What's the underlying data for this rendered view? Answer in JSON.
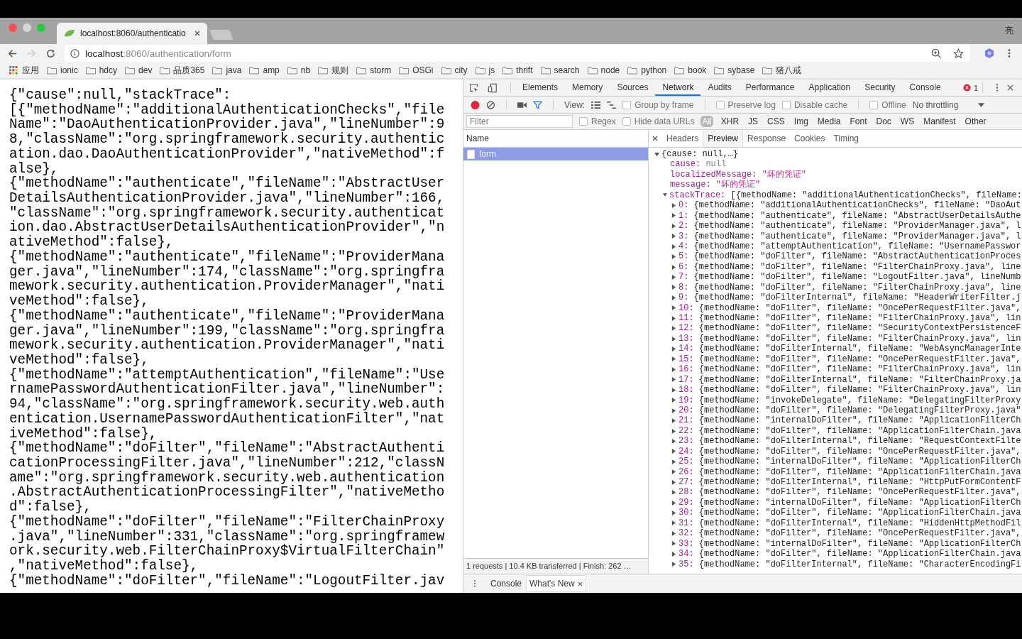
{
  "browser": {
    "tab_title": "localhost:8060/authenticatio",
    "profile_name": "亮",
    "address": {
      "host": "localhost",
      "path": ":8060/authentication/form"
    },
    "bookmarks": [
      {
        "label": "应用",
        "kind": "apps"
      },
      {
        "label": "ionic",
        "kind": "folder"
      },
      {
        "label": "hdcy",
        "kind": "folder"
      },
      {
        "label": "dev",
        "kind": "folder"
      },
      {
        "label": "品质365",
        "kind": "folder"
      },
      {
        "label": "java",
        "kind": "folder"
      },
      {
        "label": "amp",
        "kind": "folder"
      },
      {
        "label": "nb",
        "kind": "folder"
      },
      {
        "label": "规则",
        "kind": "folder"
      },
      {
        "label": "storm",
        "kind": "folder"
      },
      {
        "label": "OSGi",
        "kind": "folder"
      },
      {
        "label": "city",
        "kind": "folder"
      },
      {
        "label": "js",
        "kind": "folder"
      },
      {
        "label": "thrift",
        "kind": "folder"
      },
      {
        "label": "search",
        "kind": "folder"
      },
      {
        "label": "node",
        "kind": "folder"
      },
      {
        "label": "python",
        "kind": "folder"
      },
      {
        "label": "book",
        "kind": "folder"
      },
      {
        "label": "sybase",
        "kind": "folder"
      },
      {
        "label": "猪八戒",
        "kind": "folder"
      }
    ]
  },
  "page_text": [
    "{\"cause\":null,\"stackTrace\":",
    "[{\"methodName\":\"additionalAuthenticationChecks\",\"file",
    "Name\":\"DaoAuthenticationProvider.java\",\"lineNumber\":9",
    "8,\"className\":\"org.springframework.security.authentic",
    "ation.dao.DaoAuthenticationProvider\",\"nativeMethod\":f",
    "alse},",
    "{\"methodName\":\"authenticate\",\"fileName\":\"AbstractUser",
    "DetailsAuthenticationProvider.java\",\"lineNumber\":166,",
    "\"className\":\"org.springframework.security.authenticat",
    "ion.dao.AbstractUserDetailsAuthenticationProvider\",\"n",
    "ativeMethod\":false},",
    "{\"methodName\":\"authenticate\",\"fileName\":\"ProviderMana",
    "ger.java\",\"lineNumber\":174,\"className\":\"org.springfra",
    "mework.security.authentication.ProviderManager\",\"nati",
    "veMethod\":false},",
    "{\"methodName\":\"authenticate\",\"fileName\":\"ProviderMana",
    "ger.java\",\"lineNumber\":199,\"className\":\"org.springfra",
    "mework.security.authentication.ProviderManager\",\"nati",
    "veMethod\":false},",
    "{\"methodName\":\"attemptAuthentication\",\"fileName\":\"Use",
    "rnamePasswordAuthenticationFilter.java\",\"lineNumber\":",
    "94,\"className\":\"org.springframework.security.web.auth",
    "entication.UsernamePasswordAuthenticationFilter\",\"nat",
    "iveMethod\":false},",
    "{\"methodName\":\"doFilter\",\"fileName\":\"AbstractAuthenti",
    "cationProcessingFilter.java\",\"lineNumber\":212,\"classN",
    "ame\":\"org.springframework.security.web.authentication",
    ".AbstractAuthenticationProcessingFilter\",\"nativeMetho",
    "d\":false},",
    "{\"methodName\":\"doFilter\",\"fileName\":\"FilterChainProxy",
    ".java\",\"lineNumber\":331,\"className\":\"org.springframew",
    "ork.security.web.FilterChainProxy$VirtualFilterChain\"",
    ",\"nativeMethod\":false},",
    "{\"methodName\":\"doFilter\",\"fileName\":\"LogoutFilter.jav"
  ],
  "devtools": {
    "tabs": [
      {
        "label": "Elements",
        "selected": false
      },
      {
        "label": "Memory",
        "selected": false
      },
      {
        "label": "Sources",
        "selected": false
      },
      {
        "label": "Network",
        "selected": true
      },
      {
        "label": "Audits",
        "selected": false
      },
      {
        "label": "Performance",
        "selected": false
      },
      {
        "label": "Application",
        "selected": false
      },
      {
        "label": "Security",
        "selected": false
      },
      {
        "label": "Console",
        "selected": false
      }
    ],
    "error_count": "1",
    "toolbar": {
      "view_label": "View:",
      "checkboxes": [
        {
          "label": "Group by frame",
          "checked": false
        },
        {
          "label": "Preserve log",
          "checked": false
        },
        {
          "label": "Disable cache",
          "checked": false
        },
        {
          "label": "Offline",
          "checked": false
        }
      ],
      "throttling": "No throttling"
    },
    "filter": {
      "placeholder": "Filter",
      "checkboxes": [
        {
          "label": "Regex",
          "checked": false
        },
        {
          "label": "Hide data URLs",
          "checked": false
        }
      ],
      "types": [
        {
          "label": "All",
          "selected": true
        },
        {
          "label": "XHR",
          "selected": false
        },
        {
          "label": "JS",
          "selected": false
        },
        {
          "label": "CSS",
          "selected": false
        },
        {
          "label": "Img",
          "selected": false
        },
        {
          "label": "Media",
          "selected": false
        },
        {
          "label": "Font",
          "selected": false
        },
        {
          "label": "Doc",
          "selected": false
        },
        {
          "label": "WS",
          "selected": false
        },
        {
          "label": "Manifest",
          "selected": false
        },
        {
          "label": "Other",
          "selected": false
        }
      ]
    },
    "requests": {
      "column": "Name",
      "rows": [
        {
          "name": "form",
          "selected": true
        }
      ],
      "status": "1 requests | 10.4 KB transferred | Finish: 262 …"
    },
    "detail_tabs": [
      {
        "label": "Headers",
        "selected": false
      },
      {
        "label": "Preview",
        "selected": true
      },
      {
        "label": "Response",
        "selected": false
      },
      {
        "label": "Cookies",
        "selected": false
      },
      {
        "label": "Timing",
        "selected": false
      }
    ],
    "preview": {
      "summary": "{cause: null,…}",
      "expanded": true,
      "properties": [
        {
          "key": "cause:",
          "value": "null",
          "kind": "null"
        },
        {
          "key": "localizedMessage:",
          "value": "\"坏的凭证\"",
          "kind": "string"
        },
        {
          "key": "message:",
          "value": "\"坏的凭证\"",
          "kind": "string"
        },
        {
          "key": "stackTrace:",
          "value": "[{methodName: \"additionalAuthenticationChecks\", fileName:",
          "kind": "array",
          "expanded": true,
          "children": [
            {
              "index": "0:",
              "text": "{methodName: \"additionalAuthenticationChecks\", fileName: \"DaoAut",
              "expanded": false
            },
            {
              "index": "1:",
              "text": "{methodName: \"authenticate\", fileName: \"AbstractUserDetailsAuthe",
              "expanded": false
            },
            {
              "index": "2:",
              "text": "{methodName: \"authenticate\", fileName: \"ProviderManager.java\", l",
              "expanded": false
            },
            {
              "index": "3:",
              "text": "{methodName: \"authenticate\", fileName: \"ProviderManager.java\", l",
              "expanded": false
            },
            {
              "index": "4:",
              "text": "{methodName: \"attemptAuthentication\", fileName: \"UsernamePasswor",
              "expanded": false
            },
            {
              "index": "5:",
              "text": "{methodName: \"doFilter\", fileName: \"AbstractAuthenticationProces",
              "expanded": false
            },
            {
              "index": "6:",
              "text": "{methodName: \"doFilter\", fileName: \"FilterChainProxy.java\", line",
              "expanded": false
            },
            {
              "index": "7:",
              "text": "{methodName: \"doFilter\", fileName: \"LogoutFilter.java\", lineNumb",
              "expanded": false
            },
            {
              "index": "8:",
              "text": "{methodName: \"doFilter\", fileName: \"FilterChainProxy.java\", line",
              "expanded": false
            },
            {
              "index": "9:",
              "text": "{methodName: \"doFilterInternal\", fileName: \"HeaderWriterFilter.j",
              "expanded": false
            },
            {
              "index": "10:",
              "text": "{methodName: \"doFilter\", fileName: \"OncePerRequestFilter.java\",",
              "expanded": false
            },
            {
              "index": "11:",
              "text": "{methodName: \"doFilter\", fileName: \"FilterChainProxy.java\", lin",
              "expanded": false
            },
            {
              "index": "12:",
              "text": "{methodName: \"doFilter\", fileName: \"SecurityContextPersistenceF",
              "expanded": false
            },
            {
              "index": "13:",
              "text": "{methodName: \"doFilter\", fileName: \"FilterChainProxy.java\", lin",
              "expanded": false
            },
            {
              "index": "14:",
              "text": "{methodName: \"doFilterInternal\", fileName: \"WebAsyncManagerInte",
              "expanded": false
            },
            {
              "index": "15:",
              "text": "{methodName: \"doFilter\", fileName: \"OncePerRequestFilter.java\",",
              "expanded": false
            },
            {
              "index": "16:",
              "text": "{methodName: \"doFilter\", fileName: \"FilterChainProxy.java\", lin",
              "expanded": false
            },
            {
              "index": "17:",
              "text": "{methodName: \"doFilterInternal\", fileName: \"FilterChainProxy.ja",
              "expanded": false
            },
            {
              "index": "18:",
              "text": "{methodName: \"doFilter\", fileName: \"FilterChainProxy.java\", lin",
              "expanded": false
            },
            {
              "index": "19:",
              "text": "{methodName: \"invokeDelegate\", fileName: \"DelegatingFilterProxy",
              "expanded": false
            },
            {
              "index": "20:",
              "text": "{methodName: \"doFilter\", fileName: \"DelegatingFilterProxy.java\"",
              "expanded": false
            },
            {
              "index": "21:",
              "text": "{methodName: \"internalDoFilter\", fileName: \"ApplicationFilterCh",
              "expanded": false
            },
            {
              "index": "22:",
              "text": "{methodName: \"doFilter\", fileName: \"ApplicationFilterChain.java",
              "expanded": false
            },
            {
              "index": "23:",
              "text": "{methodName: \"doFilterInternal\", fileName: \"RequestContextFilte",
              "expanded": false
            },
            {
              "index": "24:",
              "text": "{methodName: \"doFilter\", fileName: \"OncePerRequestFilter.java\",",
              "expanded": false
            },
            {
              "index": "25:",
              "text": "{methodName: \"internalDoFilter\", fileName: \"ApplicationFilterCh",
              "expanded": false
            },
            {
              "index": "26:",
              "text": "{methodName: \"doFilter\", fileName: \"ApplicationFilterChain.java",
              "expanded": false
            },
            {
              "index": "27:",
              "text": "{methodName: \"doFilterInternal\", fileName: \"HttpPutFormContentF",
              "expanded": false
            },
            {
              "index": "28:",
              "text": "{methodName: \"doFilter\", fileName: \"OncePerRequestFilter.java\",",
              "expanded": false
            },
            {
              "index": "29:",
              "text": "{methodName: \"internalDoFilter\", fileName: \"ApplicationFilterCh",
              "expanded": false
            },
            {
              "index": "30:",
              "text": "{methodName: \"doFilter\", fileName: \"ApplicationFilterChain.java",
              "expanded": false
            },
            {
              "index": "31:",
              "text": "{methodName: \"doFilterInternal\", fileName: \"HiddenHttpMethodFil",
              "expanded": false
            },
            {
              "index": "32:",
              "text": "{methodName: \"doFilter\", fileName: \"OncePerRequestFilter.java\",",
              "expanded": false
            },
            {
              "index": "33:",
              "text": "{methodName: \"internalDoFilter\", fileName: \"ApplicationFilterCh",
              "expanded": false
            },
            {
              "index": "34:",
              "text": "{methodName: \"doFilter\", fileName: \"ApplicationFilterChain.java",
              "expanded": false
            },
            {
              "index": "35:",
              "text": "{methodName: \"doFilterInternal\", fileName: \"CharacterEncodingFi",
              "expanded": false
            }
          ]
        }
      ]
    },
    "drawer_tabs": [
      {
        "label": "Console",
        "selected": false,
        "closable": false
      },
      {
        "label": "What's New",
        "selected": true,
        "closable": true
      }
    ]
  }
}
